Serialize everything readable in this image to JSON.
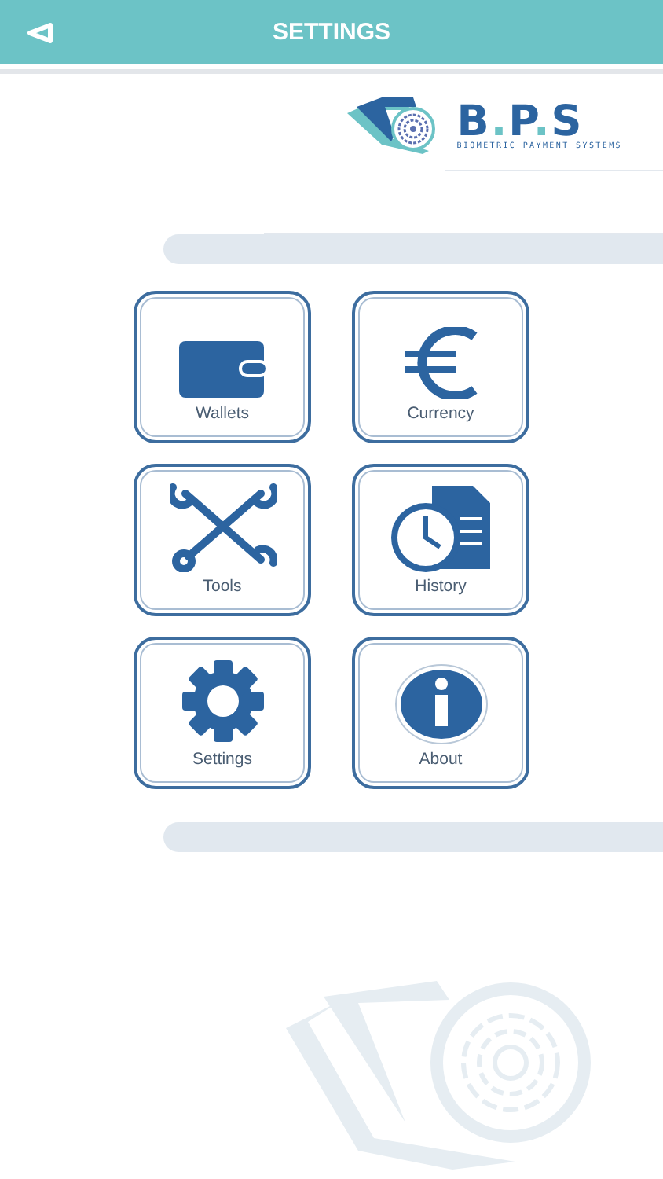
{
  "header": {
    "title": "SETTINGS"
  },
  "logo": {
    "name": "B.P.S",
    "tagline": "BIOMETRIC PAYMENT SYSTEMS"
  },
  "tiles": [
    {
      "kind": "wallet",
      "label": "Wallets"
    },
    {
      "kind": "currency",
      "label": "Currency"
    },
    {
      "kind": "tools",
      "label": "Tools"
    },
    {
      "kind": "history",
      "label": "History"
    },
    {
      "kind": "settings",
      "label": "Settings"
    },
    {
      "kind": "about",
      "label": "About"
    }
  ]
}
